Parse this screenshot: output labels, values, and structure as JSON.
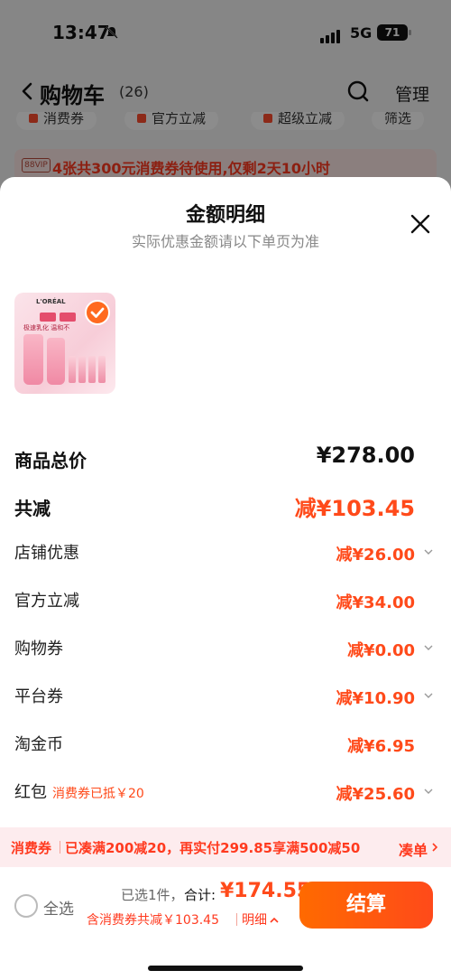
{
  "status": {
    "time": "13:47",
    "network": "5G",
    "battery": "71"
  },
  "nav": {
    "title": "购物车",
    "count": "(26)",
    "manage": "管理"
  },
  "filters": [
    "消费券",
    "官方立减",
    "超级立减",
    "筛选"
  ],
  "vip_banner": {
    "badge": "88VIP",
    "text": "4张共300元消费券待使用,仅剩2天10小时"
  },
  "sheet": {
    "title": "金额明细",
    "subtitle": "实际优惠金额请以下单页为准",
    "product": {
      "brand": "L'ORÉAL",
      "caption": "极速乳化 温和不"
    }
  },
  "rows": {
    "total": {
      "label": "商品总价",
      "value": "¥278.00"
    },
    "saving": {
      "label": "共减",
      "value": "减¥103.45"
    },
    "store": {
      "label": "店铺优惠",
      "value": "减¥26.00"
    },
    "official": {
      "label": "官方立减",
      "value": "减¥34.00"
    },
    "shopping_coupon": {
      "label": "购物券",
      "value": "减¥0.00"
    },
    "platform_coupon": {
      "label": "平台券",
      "value": "减¥10.90"
    },
    "taojinbi": {
      "label": "淘金币",
      "value": "减¥6.95"
    },
    "red_packet": {
      "label": "红包",
      "sub": "消费券已抵￥20",
      "value": "减¥25.60"
    }
  },
  "promo": {
    "label": "消费券",
    "text": "已凑满200减20，再实付299.85享满500减50",
    "action": "凑单"
  },
  "footer": {
    "select_all": "全选",
    "selected": "已选1件，",
    "total_label": "合计:",
    "total_price": "¥174.55",
    "discount_note": "含消费券共减￥103.45",
    "detail": "明细",
    "checkout": "结算"
  },
  "colors": {
    "accent": "#ff4a1a",
    "button": "#ff6a00",
    "promo_bg": "#fdecee"
  }
}
